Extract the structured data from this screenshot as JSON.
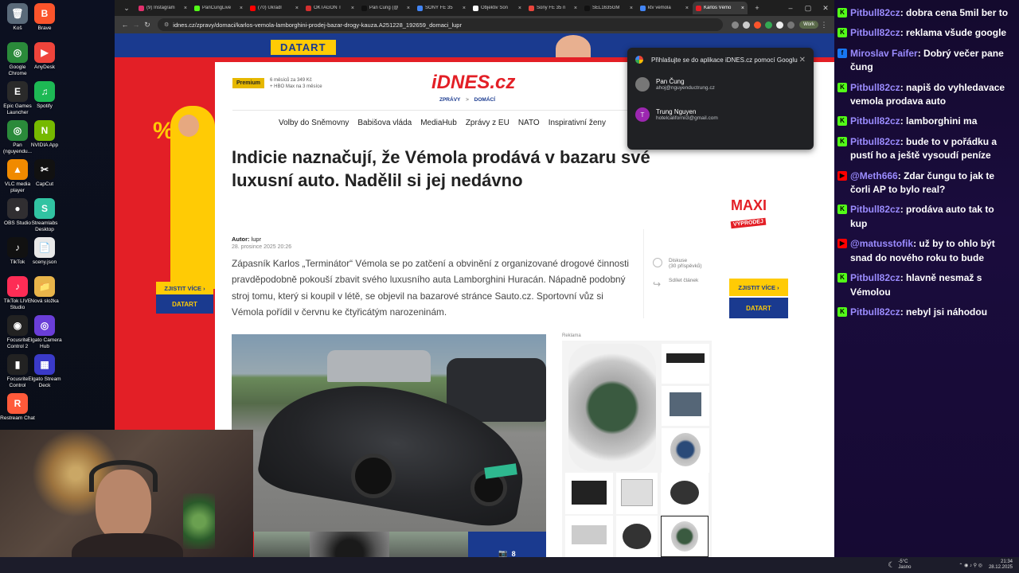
{
  "desktop": {
    "icons": [
      {
        "label": "Koš",
        "glyph": "🗑",
        "color": "#5a6a7a"
      },
      {
        "label": "Brave",
        "glyph": "B",
        "color": "#fb542b"
      },
      {
        "label": "Google Chrome",
        "glyph": "◎",
        "color": "#2a8a3a"
      },
      {
        "label": "AnyDesk",
        "glyph": "▶",
        "color": "#ef443b"
      },
      {
        "label": "Epic Games Launcher",
        "glyph": "E",
        "color": "#2a2a2a"
      },
      {
        "label": "Spotify",
        "glyph": "♫",
        "color": "#1db954"
      },
      {
        "label": "Pan (nguyendu...",
        "glyph": "◎",
        "color": "#2a8a3a"
      },
      {
        "label": "NVIDIA App",
        "glyph": "N",
        "color": "#76b900"
      },
      {
        "label": "VLC media player",
        "glyph": "▲",
        "color": "#f08a00"
      },
      {
        "label": "CapCut",
        "glyph": "✂",
        "color": "#111111"
      },
      {
        "label": "OBS Studio",
        "glyph": "●",
        "color": "#302e31"
      },
      {
        "label": "Streamlabs Desktop",
        "glyph": "S",
        "color": "#31c3a2"
      },
      {
        "label": "TikTok",
        "glyph": "♪",
        "color": "#111111"
      },
      {
        "label": "sceny.json",
        "glyph": "📄",
        "color": "#e8e8e8"
      },
      {
        "label": "TikTok LIVE Studio",
        "glyph": "♪",
        "color": "#fe2c55"
      },
      {
        "label": "Nová složka",
        "glyph": "📁",
        "color": "#e8b44a"
      },
      {
        "label": "Focusrite Control 2",
        "glyph": "◉",
        "color": "#222222"
      },
      {
        "label": "Elgato Camera Hub",
        "glyph": "◎",
        "color": "#6a3ed8"
      },
      {
        "label": "Focusrite Control",
        "glyph": "▮",
        "color": "#222222"
      },
      {
        "label": "Elgato Stream Deck",
        "glyph": "▦",
        "color": "#3a3ac8"
      },
      {
        "label": "Restream Chat",
        "glyph": "R",
        "color": "#ff5a3a"
      }
    ]
  },
  "browser": {
    "tabs": [
      {
        "label": "(9) Instagram",
        "color": "#e1306c"
      },
      {
        "label": "PanCungLive",
        "color": "#53fc18"
      },
      {
        "label": "(70) Ukradl",
        "color": "#ff0000"
      },
      {
        "label": "OKTAGON T",
        "color": "#d32f2f"
      },
      {
        "label": "Pan Čung (@",
        "color": "#111111"
      },
      {
        "label": "SONY FE 35",
        "color": "#4285f4"
      },
      {
        "label": "Objektiv Son",
        "color": "#ffffff"
      },
      {
        "label": "Sony FE 35 n",
        "color": "#e8453c"
      },
      {
        "label": "SEL1635GM",
        "color": "#111111"
      },
      {
        "label": "ktv vemola",
        "color": "#4285f4"
      },
      {
        "label": "Karlos Vémo",
        "color": "#e31f26"
      }
    ],
    "url": "idnes.cz/zpravy/domaci/karlos-vemola-lamborghini-prodej-bazar-drogy-kauza.A251228_192659_domaci_lupr",
    "profile_label": "Work"
  },
  "page": {
    "brand": "DATART",
    "premium": {
      "badge": "Premium",
      "line1": "6 měsíců za 349 Kč",
      "line2": "+ HBO Max na 3 měsíce"
    },
    "logo": "iDNES.cz",
    "breadcrumb": {
      "first": "ZPRÁVY",
      "sep": ">",
      "second": "DOMÁCÍ"
    },
    "nav": [
      "Volby do Sněmovny",
      "Babišova vláda",
      "MediaHub",
      "Zprávy z EU",
      "NATO",
      "Inspirativní ženy"
    ],
    "headline": "Indicie naznačují, že Vémola prodává v bazaru své luxusní auto. Nadělil si jej nedávno",
    "author_label": "Autor:",
    "author": "lupr",
    "date": "28. prosince 2025  20:26",
    "lead": "Zápasník Karlos „Terminátor“ Vémola se po zatčení a obvinění z organizované drogové činnosti pravděpodobně pokouší zbavit svého luxusního auta Lamborghini Huracán. Nápadně podobný stroj tomu, který si koupil v létě, se objevil na bazarové stránce Sauto.cz. Sportovní vůz si Vémola pořídil v červnu ke čtyřicátým narozeninám.",
    "discussion_label": "Diskuse",
    "discussion_count": "(30 příspěvků)",
    "share_label": "Sdílet článek",
    "gallery_count": "8",
    "ad_label": "Reklama",
    "cta": "ZJISTIT VÍCE",
    "maxi": "MAXI",
    "vyprodej": "VÝPRODEJ",
    "side_letter": "%"
  },
  "google_popup": {
    "title": "Přihlašujte se do aplikace iDNES.cz pomocí Googlu",
    "accounts": [
      {
        "name": "Pan Čung",
        "email": "ahoj@nguyenductrung.cz",
        "initial": ""
      },
      {
        "name": "Trung Nguyen",
        "email": "hotelcalifornii3@gmail.com",
        "initial": "T"
      }
    ]
  },
  "chat": {
    "messages": [
      {
        "user": "Pitbull82cz",
        "text": "dobra cena 5mil ber to",
        "platform": "kick",
        "color": "#53fc18"
      },
      {
        "user": "Pitbull82cz",
        "text": "reklama všude google",
        "platform": "kick",
        "color": "#53fc18"
      },
      {
        "user": "Miroslav Faifer",
        "text": "Dobrý večer pane čung",
        "platform": "facebook",
        "color": "#1877f2"
      },
      {
        "user": "Pitbull82cz",
        "text": "napiš do vyhledavace vemola prodava auto",
        "platform": "kick",
        "color": "#53fc18"
      },
      {
        "user": "Pitbull82cz",
        "text": "lamborghini ma",
        "platform": "kick",
        "color": "#53fc18"
      },
      {
        "user": "Pitbull82cz",
        "text": "bude to v pořádku a pustí ho a ještě vysoudí peníze",
        "platform": "kick",
        "color": "#53fc18"
      },
      {
        "user": "@Meth666",
        "text": "Zdar čungu to jak te čorli AP to bylo real?",
        "platform": "youtube",
        "color": "#ff0000"
      },
      {
        "user": "Pitbull82cz",
        "text": "prodáva auto tak to kup",
        "platform": "kick",
        "color": "#53fc18"
      },
      {
        "user": "@matusstofik",
        "text": "už by to ohlo být snad do nového roku to bude",
        "platform": "youtube",
        "color": "#ff0000"
      },
      {
        "user": "Pitbull82cz",
        "text": "hlavně nesmaž s Vémolou",
        "platform": "kick",
        "color": "#53fc18"
      },
      {
        "user": "Pitbull82cz",
        "text": "nebyl jsi náhodou",
        "platform": "kick",
        "color": "#53fc18"
      }
    ],
    "user_color": "#9b8cff"
  },
  "taskbar": {
    "weather_temp": "-5°C",
    "weather_text": "Jasno",
    "time": "21:34",
    "date": "28.12.2025"
  }
}
